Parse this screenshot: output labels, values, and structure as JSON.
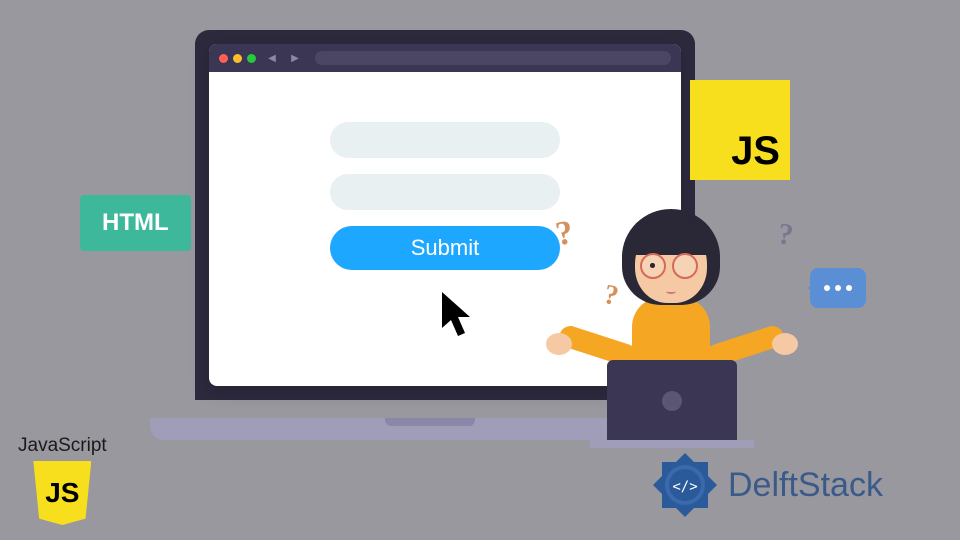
{
  "form": {
    "submit_label": "Submit"
  },
  "badges": {
    "html": "HTML",
    "js": "JS"
  },
  "logos": {
    "javascript_label": "JavaScript",
    "javascript_shield": "JS",
    "delftstack": "DelftStack"
  },
  "decorative": {
    "question_mark": "?"
  }
}
